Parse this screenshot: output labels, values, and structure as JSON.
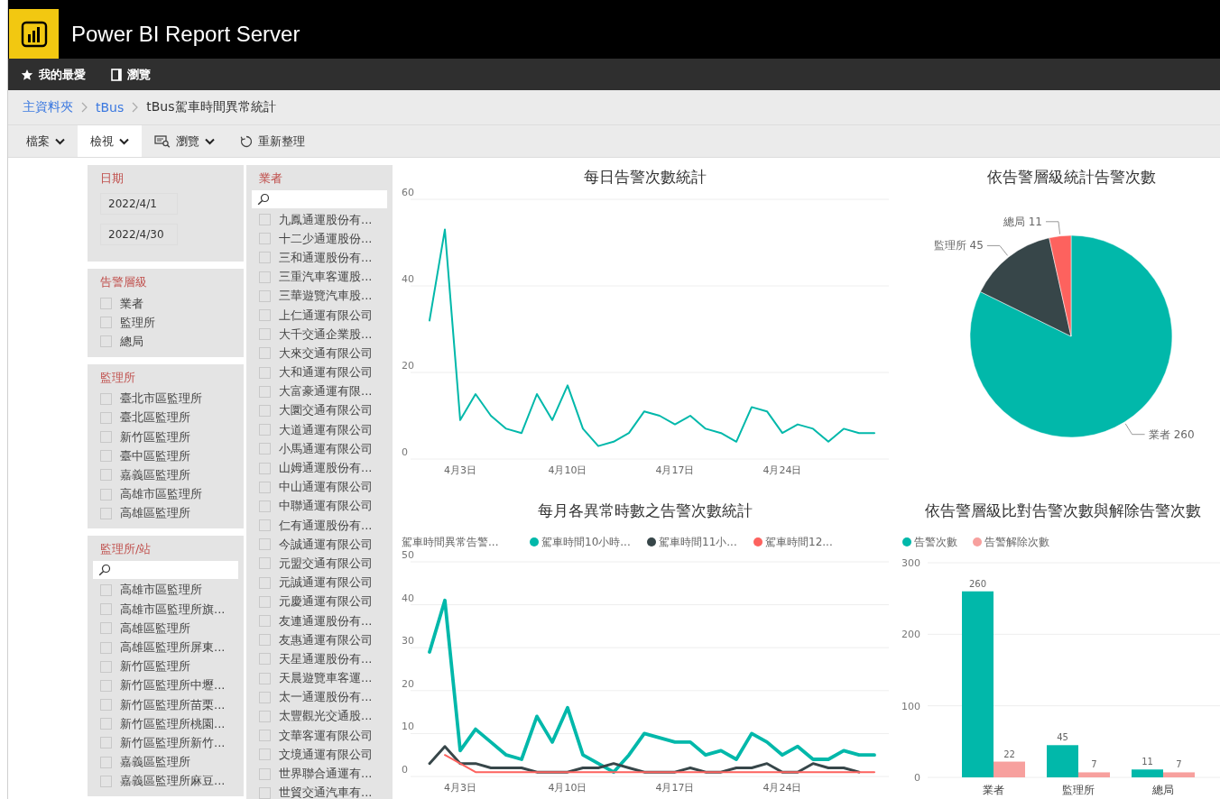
{
  "header": {
    "title": "Power BI Report Server"
  },
  "nav": [
    {
      "label": "我的最愛",
      "kind": "favorites"
    },
    {
      "label": "瀏覽",
      "kind": "browse"
    }
  ],
  "breadcrumb": [
    {
      "label": "主資料夾",
      "kind": "link"
    },
    {
      "label": "tBus",
      "kind": "link"
    },
    {
      "label": "tBus駕車時間異常統計",
      "kind": "current"
    }
  ],
  "toolbar": [
    {
      "label": "檔案",
      "kind": "menu",
      "dropdown": true,
      "selected": false
    },
    {
      "label": "檢視",
      "kind": "menu",
      "dropdown": true,
      "selected": true
    },
    {
      "label": "瀏覽",
      "kind": "browse",
      "dropdown": true,
      "selected": false
    },
    {
      "label": "重新整理",
      "kind": "refresh",
      "dropdown": false,
      "selected": false
    }
  ],
  "filter_columns": [
    {
      "filters": [
        {
          "kind": "date",
          "title": "日期",
          "values": [
            "2022/4/1",
            "2022/4/30"
          ]
        },
        {
          "kind": "list",
          "title": "告警層級",
          "search": false,
          "items": [
            {
              "label": "業者",
              "checked": false
            },
            {
              "label": "監理所",
              "checked": false
            },
            {
              "label": "總局",
              "checked": false
            }
          ]
        },
        {
          "kind": "list",
          "title": "監理所",
          "search": false,
          "items": [
            {
              "label": "臺北市區監理所",
              "checked": false
            },
            {
              "label": "臺北區監理所",
              "checked": false
            },
            {
              "label": "新竹區監理所",
              "checked": false
            },
            {
              "label": "臺中區監理所",
              "checked": false
            },
            {
              "label": "嘉義區監理所",
              "checked": false
            },
            {
              "label": "高雄市區監理所",
              "checked": false
            },
            {
              "label": "高雄區監理所",
              "checked": false
            }
          ]
        },
        {
          "kind": "list",
          "title": "監理所/站",
          "search": true,
          "items": [
            {
              "label": "高雄市區監理所",
              "checked": false
            },
            {
              "label": "高雄市區監理所旗...",
              "checked": false
            },
            {
              "label": "高雄區監理所",
              "checked": false
            },
            {
              "label": "高雄區監理所屏東...",
              "checked": false
            },
            {
              "label": "新竹區監理所",
              "checked": false
            },
            {
              "label": "新竹區監理所中壢...",
              "checked": false
            },
            {
              "label": "新竹區監理所苗栗...",
              "checked": false
            },
            {
              "label": "新竹區監理所桃園...",
              "checked": false
            },
            {
              "label": "新竹區監理所新竹...",
              "checked": false
            },
            {
              "label": "嘉義區監理所",
              "checked": false
            },
            {
              "label": "嘉義區監理所麻豆...",
              "checked": false
            }
          ]
        }
      ]
    },
    {
      "filters": [
        {
          "kind": "list",
          "title": "業者",
          "search": true,
          "items": [
            {
              "label": "九鳳通運股份有...",
              "checked": false
            },
            {
              "label": "十二少通運股份...",
              "checked": false
            },
            {
              "label": "三和通運股份有...",
              "checked": false
            },
            {
              "label": "三重汽車客運股...",
              "checked": false
            },
            {
              "label": "三華遊覽汽車股...",
              "checked": false
            },
            {
              "label": "上仁通運有限公司",
              "checked": false
            },
            {
              "label": "大千交通企業股...",
              "checked": false
            },
            {
              "label": "大來交通有限公司",
              "checked": false
            },
            {
              "label": "大和通運有限公司",
              "checked": false
            },
            {
              "label": "大富豪通運有限...",
              "checked": false
            },
            {
              "label": "大圜交通有限公司",
              "checked": false
            },
            {
              "label": "大道通運有限公司",
              "checked": false
            },
            {
              "label": "小馬通運有限公司",
              "checked": false
            },
            {
              "label": "山姆通運股份有...",
              "checked": false
            },
            {
              "label": "中山通運有限公司",
              "checked": false
            },
            {
              "label": "中聯通運有限公司",
              "checked": false
            },
            {
              "label": "仁有通運股份有...",
              "checked": false
            },
            {
              "label": "今誠通運有限公司",
              "checked": false
            },
            {
              "label": "元盟交通有限公司",
              "checked": false
            },
            {
              "label": "元誠通運有限公司",
              "checked": false
            },
            {
              "label": "元慶通運有限公司",
              "checked": false
            },
            {
              "label": "友連通運股份有...",
              "checked": false
            },
            {
              "label": "友惠通運有限公司",
              "checked": false
            },
            {
              "label": "天星通運股份有...",
              "checked": false
            },
            {
              "label": "天晨遊覽車客運...",
              "checked": false
            },
            {
              "label": "太一通運股份有...",
              "checked": false
            },
            {
              "label": "太豐觀光交通股...",
              "checked": false
            },
            {
              "label": "文華客運有限公司",
              "checked": false
            },
            {
              "label": "文境通運有限公司",
              "checked": false
            },
            {
              "label": "世界聯合通運有...",
              "checked": false
            },
            {
              "label": "世貿交通汽車有...",
              "checked": false
            }
          ]
        }
      ]
    }
  ],
  "charts": [
    {
      "chart_data": {
        "type": "line",
        "title": "每日告警次數統計",
        "grid": true,
        "categories": [
          null,
          null,
          "4月3日",
          null,
          null,
          null,
          null,
          null,
          null,
          "4月10日",
          null,
          null,
          null,
          null,
          null,
          null,
          "4月17日",
          null,
          null,
          null,
          null,
          null,
          null,
          "4月24日",
          null,
          null,
          null,
          null,
          null,
          null
        ],
        "ylim": [
          0,
          60
        ],
        "yticks": [
          0,
          20,
          40,
          60
        ],
        "series": [
          {
            "color": "#01b8aa",
            "values": [
              32,
              53,
              9,
              15,
              10,
              7,
              6,
              15,
              9,
              17,
              7,
              3,
              4,
              6,
              11,
              10,
              8,
              10,
              7,
              6,
              4,
              12,
              11,
              6,
              8,
              7,
              4,
              7,
              6,
              6
            ]
          }
        ]
      }
    },
    {
      "chart_data": {
        "type": "pie",
        "title": "依告警層級統計告警次數",
        "categories": [
          "業者",
          "監理所",
          "總局"
        ],
        "values": [
          260,
          45,
          11
        ],
        "colors": [
          "#01b8aa",
          "#374649",
          "#fd625e"
        ],
        "data_labels": true
      }
    },
    {
      "chart_data": {
        "type": "line",
        "title": "每月各異常時數之告警次數統計",
        "legend": {
          "title": "駕車時間異常告警..."
        },
        "grid": true,
        "categories": [
          null,
          null,
          "4月3日",
          null,
          null,
          null,
          null,
          null,
          null,
          "4月10日",
          null,
          null,
          null,
          null,
          null,
          null,
          "4月17日",
          null,
          null,
          null,
          null,
          null,
          null,
          "4月24日",
          null,
          null,
          null,
          null,
          null,
          null
        ],
        "ylim": [
          0,
          50
        ],
        "yticks": [
          0,
          10,
          20,
          30,
          40,
          50
        ],
        "series": [
          {
            "name": "駕車時間10小時...",
            "color": "#01b8aa",
            "values": [
              29,
              41,
              6,
              11,
              8,
              5,
              4,
              14,
              8,
              16,
              5,
              3,
              1,
              5,
              10,
              9,
              8,
              8,
              5,
              6,
              4,
              10,
              8,
              5,
              7,
              4,
              4,
              6,
              5,
              5
            ]
          },
          {
            "name": "駕車時間11小...",
            "color": "#374649",
            "values": [
              3,
              7,
              3,
              3,
              2,
              2,
              2,
              1,
              1,
              1,
              2,
              2,
              3,
              2,
              1,
              1,
              1,
              2,
              1,
              1,
              2,
              2,
              3,
              1,
              1,
              3,
              2,
              2,
              1,
              null
            ]
          },
          {
            "name": "駕車時間12...",
            "color": "#fd625e",
            "values": [
              null,
              5,
              3,
              1,
              1,
              1,
              1,
              1,
              1,
              1,
              1,
              1,
              1,
              1,
              1,
              1,
              1,
              1,
              1,
              1,
              1,
              1,
              1,
              1,
              1,
              1,
              1,
              1,
              1,
              1
            ]
          }
        ]
      }
    },
    {
      "chart_data": {
        "type": "bar",
        "title": "依告警層級比對告警次數與解除告警次數",
        "legend": true,
        "grid": true,
        "categories": [
          "業者",
          "監理所",
          "總局"
        ],
        "ylim": [
          0,
          300
        ],
        "yticks": [
          0,
          100,
          200,
          300
        ],
        "data_labels": true,
        "series": [
          {
            "name": "告警次數",
            "color": "#01b8aa",
            "values": [
              260,
              45,
              11
            ]
          },
          {
            "name": "告警解除次數",
            "color": "#f7a09e",
            "values": [
              22,
              7,
              7
            ]
          }
        ]
      }
    }
  ]
}
